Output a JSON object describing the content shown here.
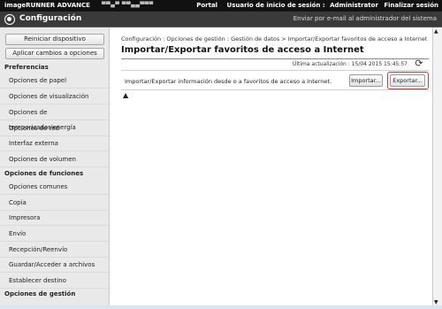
{
  "topbar": {
    "brand": "imageRUNNER ADVANCE",
    "device": "▀▀▄▀ ▀▀▄▄▀▀▀",
    "portal": "Portal",
    "login_label": "Usuario de inicio de sesión :",
    "login_user": "Administrator",
    "logout": "Finalizar sesión"
  },
  "header": {
    "title": "Configuración",
    "mail_link": "Enviar por e-mail al administrador del sistema"
  },
  "sidebar": {
    "restart_button": "Reiniciar dispositivo",
    "apply_button": "Aplicar cambios a opciones",
    "sections": [
      {
        "label": "Preferencias",
        "items": [
          "Opciones de papel",
          "Opciones de visualización",
          "Opciones de temporizador/energía",
          "Opciones de red",
          "Interfaz externa",
          "Opciones de volumen"
        ]
      },
      {
        "label": "Opciones de funciones",
        "items": [
          "Opciones comunes",
          "Copia",
          "Impresora",
          "Envío",
          "Recepción/Reenvío",
          "Guardar/Acceder a archivos",
          "Establecer destino"
        ]
      },
      {
        "label": "Opciones de gestión",
        "items": []
      }
    ]
  },
  "main": {
    "breadcrumb": "Configuración : Opciones de gestión : Gestión de datos > Importar/Exportar favoritos de acceso a Internet",
    "title": "Importar/Exportar favoritos de acceso a Internet",
    "updated": "Última actualización : 15/04 2015 15:45:57",
    "description": "Importar/Exportar información desde o a favoritos de acceso a Internet.",
    "import_button": "Importar...",
    "export_button": "Exportar..."
  },
  "colors": {
    "topbar": "#111111",
    "header": "#3a3a3a",
    "sidebar": "#e9e9e9",
    "highlight": "#e0302a"
  }
}
